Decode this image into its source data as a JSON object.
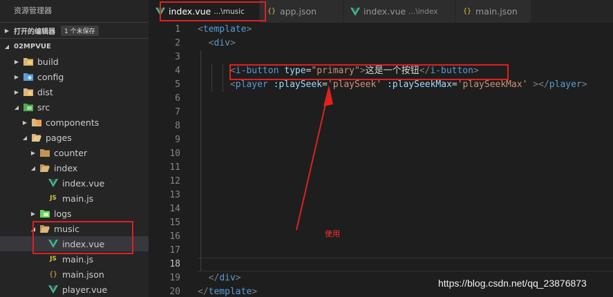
{
  "explorer": {
    "title": "资源管理器",
    "open_editors": {
      "label": "打开的编辑器",
      "badge": "1 个未保存"
    },
    "project": {
      "label": "02MPVUE"
    },
    "tree": [
      {
        "name": "build"
      },
      {
        "name": "config"
      },
      {
        "name": "dist"
      },
      {
        "name": "src"
      },
      {
        "name": "components"
      },
      {
        "name": "pages"
      },
      {
        "name": "counter"
      },
      {
        "name": "index"
      },
      {
        "name": "index.vue"
      },
      {
        "name": "main.js"
      },
      {
        "name": "logs"
      },
      {
        "name": "music"
      },
      {
        "name": "index.vue"
      },
      {
        "name": "main.js"
      },
      {
        "name": "main.json"
      },
      {
        "name": "player.vue"
      }
    ]
  },
  "tabs": [
    {
      "name": "index.vue",
      "desc": "...\\music",
      "icon": "vue-icon"
    },
    {
      "name": "app.json",
      "desc": "",
      "icon": "json-icon"
    },
    {
      "name": "index.vue",
      "desc": "...\\index",
      "icon": "vue-icon"
    },
    {
      "name": "main.json",
      "desc": "",
      "icon": "json-icon"
    }
  ],
  "editor": {
    "line_numbers": [
      "1",
      "2",
      "3",
      "4",
      "5",
      "6",
      "7",
      "8",
      "9",
      "10",
      "11",
      "12",
      "13",
      "14",
      "15",
      "16",
      "17",
      "18",
      "19",
      "20"
    ],
    "current_line": "18",
    "code": {
      "l1": {
        "open": "<",
        "tag": "template",
        "close": ">"
      },
      "l2": {
        "open": "<",
        "tag": "div",
        "close": ">"
      },
      "l4": {
        "open": "<",
        "tag": "i-button",
        "attr": "type",
        "eq": "=",
        "val": "\"primary\"",
        "close": ">",
        "text": "这是一个按钮",
        "end_open": "</",
        "end_tag": "i-button",
        "end_close": ">"
      },
      "l5": {
        "open": "<",
        "tag": "player",
        "attr1": ":playSeek",
        "eq1": "=",
        "val1": "'playSeek'",
        "attr2": ":playSeekMax",
        "eq2": "=",
        "val2": "'playSeekMax'",
        "close": " >",
        "end_open": "</",
        "end_tag": "player",
        "end_close": ">"
      },
      "l19": {
        "open": "</",
        "tag": "div",
        "close": ">"
      },
      "l20": {
        "open": "</",
        "tag": "template",
        "close": ">"
      }
    }
  },
  "annotation": {
    "note": "使用",
    "color": "#e02020"
  },
  "watermark": "https://blog.csdn.net/qq_23876873",
  "colors": {
    "vue": "#41b883",
    "folder": "#dcb67a",
    "src_folder": "#4caf50",
    "logs_folder": "#6fd35d",
    "config_folder": "#5aa0d8"
  }
}
